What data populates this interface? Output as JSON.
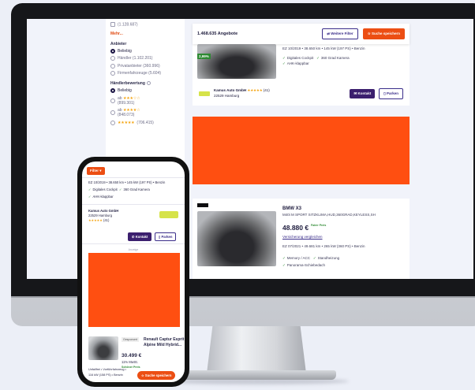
{
  "sidebar": {
    "top_count": "(1.128.687)",
    "more_label": "Mehr...",
    "provider_heading": "Anbieter",
    "provider_options": [
      {
        "label": "Beliebig",
        "selected": true
      },
      {
        "label": "Händler (1.102.201)",
        "selected": false
      },
      {
        "label": "Privatanbieter (360.996)",
        "selected": false
      },
      {
        "label": "Firmenfahrzeuge (5.604)",
        "selected": false
      }
    ],
    "rating_heading": "Händlerbewertung",
    "rating_options": [
      {
        "label": "Beliebig",
        "stars": "",
        "count": "",
        "selected": true
      },
      {
        "label": "ab",
        "stars": "★★★☆☆",
        "count": "(899.301)",
        "selected": false
      },
      {
        "label": "ab",
        "stars": "★★★★☆",
        "count": "(848.073)",
        "selected": false
      },
      {
        "label": "",
        "stars": "★★★★★",
        "count": "(706.415)",
        "selected": false
      }
    ]
  },
  "topbar": {
    "count": "1.468.635 Angebote",
    "filter_button": "Weitere Filter",
    "save_search_button": "Suche speichern"
  },
  "listing1": {
    "price_badge": "2,99%",
    "specs": "EZ 10/2019 • 38.650 km • 145 kW (197 PS) • Benzin",
    "features": [
      "Digitales Cockpit",
      "360 Grad Kamera",
      "AHK-klappbar"
    ],
    "dealer_name": "Kamus Auto GmbH",
    "dealer_stars": "★★★★★",
    "dealer_reviews": "(41)",
    "dealer_city": "22529 Hamburg",
    "contact_button": "Kontakt",
    "park_button": "Parken"
  },
  "listing2": {
    "title": "BMW X3",
    "subtitle": "M40i M SPORT SITZKLIMA,HUD,360GRAD,KEYLESS,SH",
    "price": "48.880 €",
    "price_badge": "Fairer Preis",
    "insurance_link": "Versicherung vergleichen",
    "specs": "EZ 07/2021 • 49.681 km • 265 kW (360 PS) • Benzin",
    "features": [
      "Memory / ACC",
      "Standheizung",
      "Panorama-Schiebedach"
    ]
  },
  "phone": {
    "filter_button": "Filter",
    "specs": "EZ 10/2019 • 38.650 km • 145 kW (197 PS) • Benzin",
    "features": [
      "Digitales Cockpit",
      "360 Grad Kamera",
      "AHK-klappbar"
    ],
    "dealer_name": "Kamus Auto GmbH",
    "dealer_city": "22529 Hamburg",
    "dealer_stars": "★★★★★",
    "dealer_reviews": "(41)",
    "contact_button": "Kontakt",
    "park_button": "Parken",
    "ad_label": "Anzeige",
    "tag": "Gesponsert",
    "car_title": "Renault Captur Esprit Alpine Mild Hybrid...",
    "car_price": "30.499 €",
    "car_rate": "11% MwSt.",
    "car_badge": "Schöner Preis",
    "footer_specs": "Unfallfrei • Vorführfahrzeug •",
    "footer_power": "116 kW (158 PS) • Benzin",
    "save_search_button": "Suche speichern"
  },
  "colors": {
    "accent": "#ec4e13",
    "primary": "#3b1f6e",
    "ad": "#ff4f11"
  }
}
